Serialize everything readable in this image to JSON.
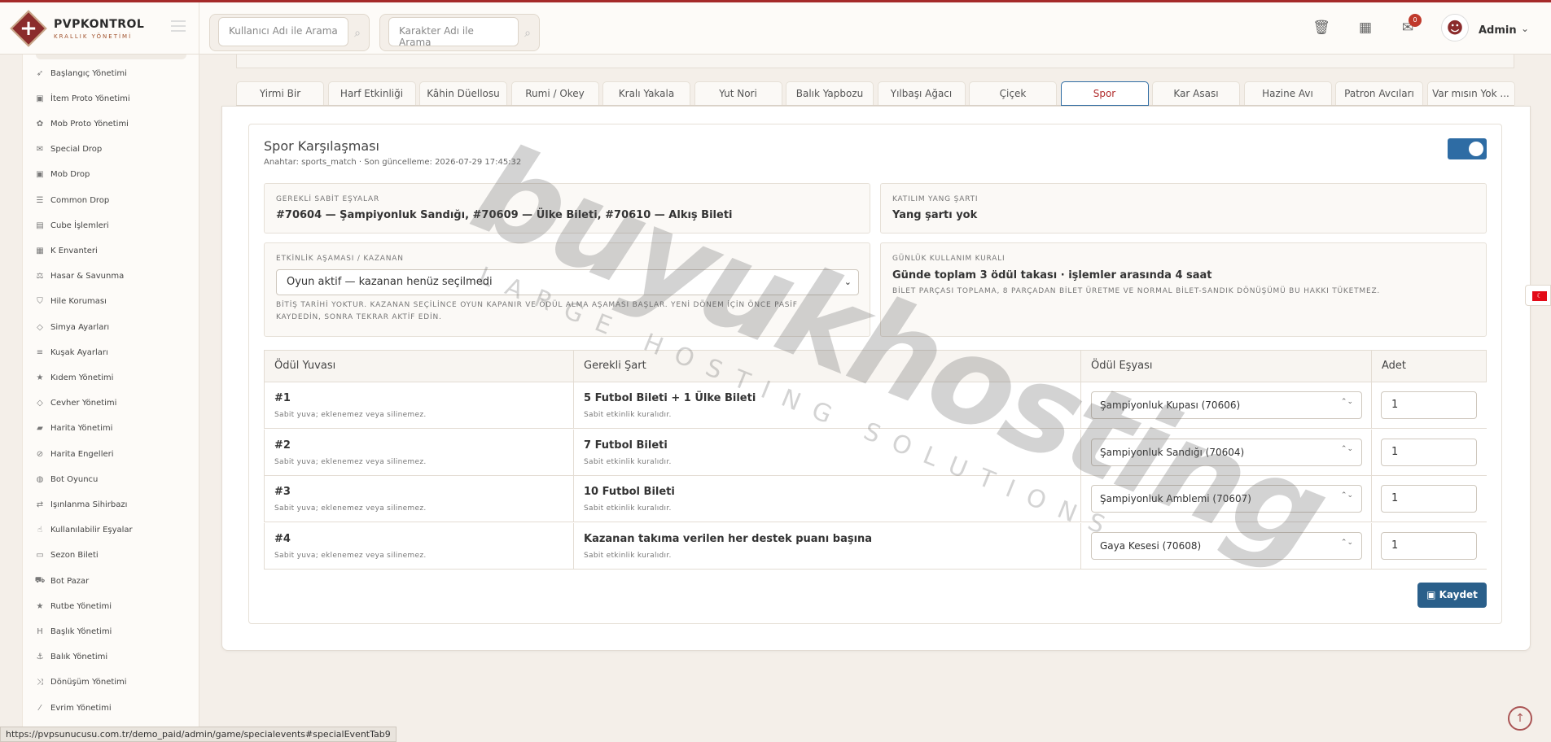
{
  "brand": {
    "title": "PVPKONTROL",
    "subtitle": "KRALLIK YÖNETİMİ"
  },
  "header": {
    "user_search_placeholder": "Kullanıcı Adı ile Arama",
    "char_search_placeholder": "Karakter Adı ile Arama",
    "mail_badge": "0",
    "admin_name": "Admin"
  },
  "sidebar": {
    "items": [
      {
        "label": "Başlangıç Yönetimi",
        "icon": "rocket-icon"
      },
      {
        "label": "İtem Proto Yönetimi",
        "icon": "box-icon"
      },
      {
        "label": "Mob Proto Yönetimi",
        "icon": "paw-icon"
      },
      {
        "label": "Special Drop",
        "icon": "gift-icon"
      },
      {
        "label": "Mob Drop",
        "icon": "box-icon"
      },
      {
        "label": "Common Drop",
        "icon": "list-icon"
      },
      {
        "label": "Cube İşlemleri",
        "icon": "cube-icon"
      },
      {
        "label": "K Envanteri",
        "icon": "grid-icon"
      },
      {
        "label": "Hasar & Savunma",
        "icon": "scale-icon"
      },
      {
        "label": "Hile Koruması",
        "icon": "shield-icon"
      },
      {
        "label": "Simya Ayarları",
        "icon": "gem-icon"
      },
      {
        "label": "Kuşak Ayarları",
        "icon": "sliders-icon"
      },
      {
        "label": "Kıdem Yönetimi",
        "icon": "star-icon"
      },
      {
        "label": "Cevher Yönetimi",
        "icon": "gem-icon"
      },
      {
        "label": "Harita Yönetimi",
        "icon": "map-icon"
      },
      {
        "label": "Harita Engelleri",
        "icon": "ban-icon"
      },
      {
        "label": "Bot Oyuncu",
        "icon": "robot-icon"
      },
      {
        "label": "Işınlanma Sihirbazı",
        "icon": "teleport-icon"
      },
      {
        "label": "Kullanılabilir Eşyalar",
        "icon": "hand-icon"
      },
      {
        "label": "Sezon Bileti",
        "icon": "ticket-icon"
      },
      {
        "label": "Bot Pazar",
        "icon": "cart-icon"
      },
      {
        "label": "Rutbe Yönetimi",
        "icon": "star-icon"
      },
      {
        "label": "Başlık Yönetimi",
        "icon": "heading-icon"
      },
      {
        "label": "Balık Yönetimi",
        "icon": "anchor-icon"
      },
      {
        "label": "Dönüşüm Yönetimi",
        "icon": "shuffle-icon"
      },
      {
        "label": "Evrim Yönetimi",
        "icon": "wand-icon"
      }
    ]
  },
  "tabs": [
    "Yirmi Bir",
    "Harf Etkinliği",
    "Kâhin Düellosu",
    "Rumi / Okey",
    "Kralı Yakala",
    "Yut Nori",
    "Balık Yapbozu",
    "Yılbaşı Ağacı",
    "Çiçek",
    "Spor",
    "Kar Asası",
    "Hazine Avı",
    "Patron Avcıları",
    "Var mısın Yok ..."
  ],
  "active_tab": "Spor",
  "event": {
    "title": "Spor Karşılaşması",
    "meta": "Anahtar: sports_match · Son güncelleme: 2026-07-29 17:45:32",
    "enabled": true,
    "required_items_label": "GEREKLİ SABİT EŞYALAR",
    "required_items_value": "#70604 — Şampiyonluk Sandığı, #70609 — Ülke Bileti, #70610 — Alkış Bileti",
    "yang_label": "KATILIM YANG ŞARTI",
    "yang_value": "Yang şartı yok",
    "phase_label": "ETKİNLİK AŞAMASI / KAZANAN",
    "phase_selected": "Oyun aktif — kazanan henüz seçilmedi",
    "phase_note": "BİTİŞ TARİHİ YOKTUR. KAZANAN SEÇİLİNCE OYUN KAPANIR VE ÖDÜL ALMA AŞAMASI BAŞLAR. YENİ DÖNEM İÇİN ÖNCE PASİF KAYDEDİN, SONRA TEKRAR AKTİF EDİN.",
    "daily_label": "GÜNLÜK KULLANIM KURALI",
    "daily_value": "Günde toplam 3 ödül takası · işlemler arasında 4 saat",
    "daily_note": "BİLET PARÇASI TOPLAMA, 8 PARÇADAN BİLET ÜRETME VE NORMAL BİLET-SANDIK DÖNÜŞÜMÜ BU HAKKI TÜKETMEZ."
  },
  "table": {
    "headers": [
      "Ödül Yuvası",
      "Gerekli Şart",
      "Ödül Eşyası",
      "Adet"
    ],
    "rows": [
      {
        "slot": "#1",
        "slot_note": "Sabit yuva; eklenemez veya silinemez.",
        "condition": "5 Futbol Bileti + 1 Ülke Bileti",
        "condition_note": "Sabit etkinlik kuralıdır.",
        "item": "Şampiyonluk Kupası (70606)",
        "qty": "1"
      },
      {
        "slot": "#2",
        "slot_note": "Sabit yuva; eklenemez veya silinemez.",
        "condition": "7 Futbol Bileti",
        "condition_note": "Sabit etkinlik kuralıdır.",
        "item": "Şampiyonluk Sandığı (70604)",
        "qty": "1"
      },
      {
        "slot": "#3",
        "slot_note": "Sabit yuva; eklenemez veya silinemez.",
        "condition": "10 Futbol Bileti",
        "condition_note": "Sabit etkinlik kuralıdır.",
        "item": "Şampiyonluk Amblemi (70607)",
        "qty": "1"
      },
      {
        "slot": "#4",
        "slot_note": "Sabit yuva; eklenemez veya silinemez.",
        "condition": "Kazanan takıma verilen her destek puanı başına",
        "condition_note": "Sabit etkinlik kuralıdır.",
        "item": "Gaya Kesesi (70608)",
        "qty": "1"
      }
    ]
  },
  "save_label": "Kaydet",
  "watermark": {
    "main": "buyukhosting",
    "sub": "LARGE HOSTING SOLUTIONS"
  },
  "status_url": "https://pvpsunucusu.com.tr/demo_paid/admin/game/specialevents#specialEventTab9",
  "colors": {
    "brand": "#8b2c2c",
    "accent": "#2e6ca4",
    "save": "#2a5f8a"
  }
}
